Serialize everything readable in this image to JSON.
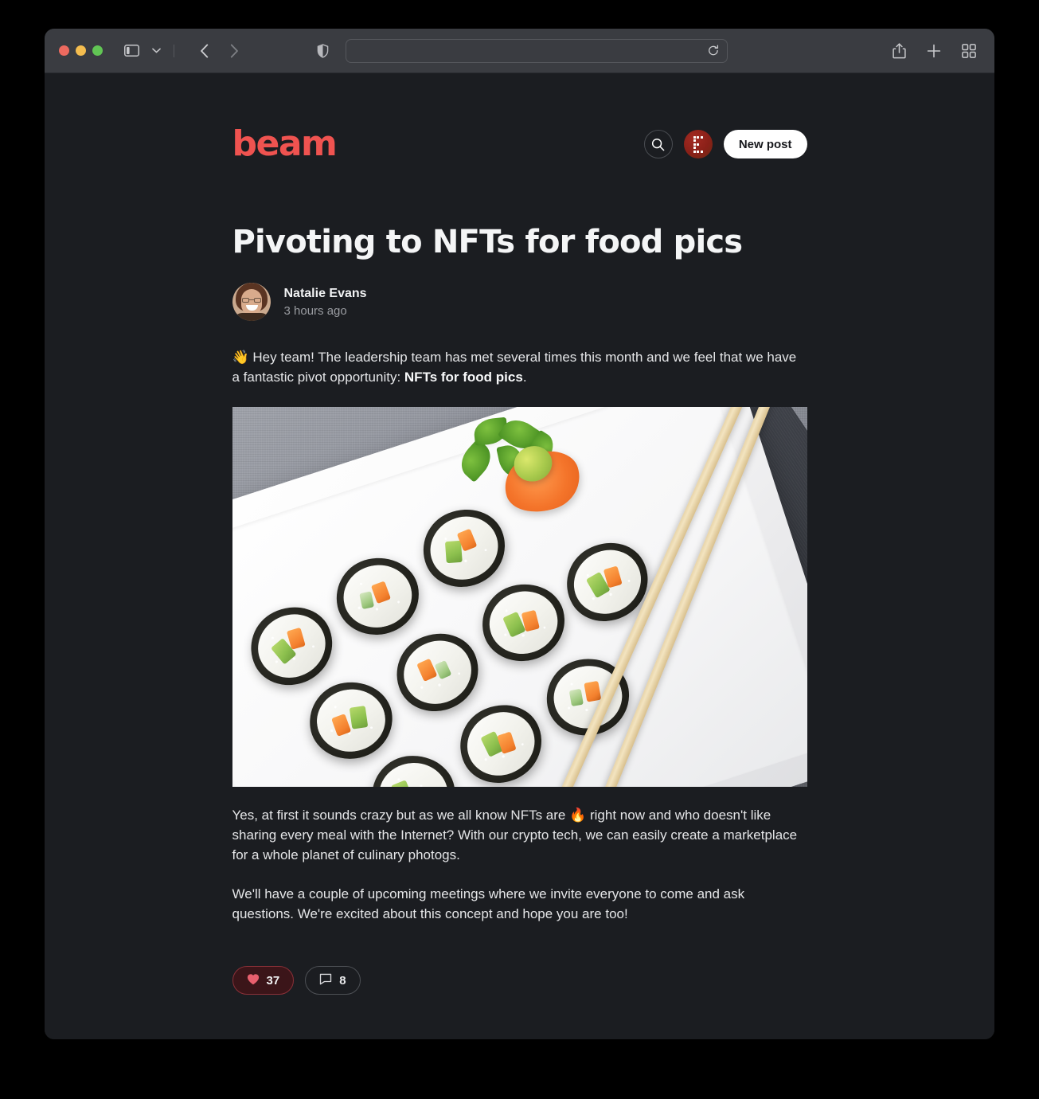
{
  "browser": {
    "url_value": "",
    "url_placeholder": "",
    "traffic_lights": [
      "close",
      "minimize",
      "zoom"
    ],
    "icons": {
      "sidebar": "sidebar-icon",
      "sidebar_chevron": "chevron-down-icon",
      "back": "back-arrow-icon",
      "forward": "forward-arrow-icon",
      "shield": "privacy-shield-icon",
      "reload": "reload-icon",
      "share": "share-icon",
      "new_tab": "plus-icon",
      "tab_overview": "tab-grid-icon"
    }
  },
  "site": {
    "logo_text": "beam",
    "brand_color": "#ef5350",
    "search_icon": "search-icon",
    "avatar_icon": "user-identicon",
    "new_post_label": "New post"
  },
  "post": {
    "title": "Pivoting to NFTs for food pics",
    "author": "Natalie Evans",
    "timestamp": "3 hours ago",
    "paragraph_1_lead": "👋 Hey team! The leadership team has met several times this month and we feel that we have a fantastic pivot opportunity: ",
    "paragraph_1_bold": "NFTs for food pics",
    "paragraph_1_tail": ".",
    "image_alt": "Sushi rolls on a white plate with chopsticks",
    "paragraph_2": "Yes, at first it sounds crazy but as we all know NFTs are 🔥 right now and who doesn't like sharing every meal with the Internet? With our crypto tech, we can easily create a marketplace for a whole planet of culinary photogs.",
    "paragraph_3": "We'll have a couple of upcoming meetings where we invite everyone to come and ask questions. We're excited about this concept and hope you are too!"
  },
  "reactions": {
    "like_icon": "heart-icon",
    "like_count": "37",
    "comment_icon": "comment-bubble-icon",
    "comment_count": "8",
    "like_color": "#e8606e"
  }
}
